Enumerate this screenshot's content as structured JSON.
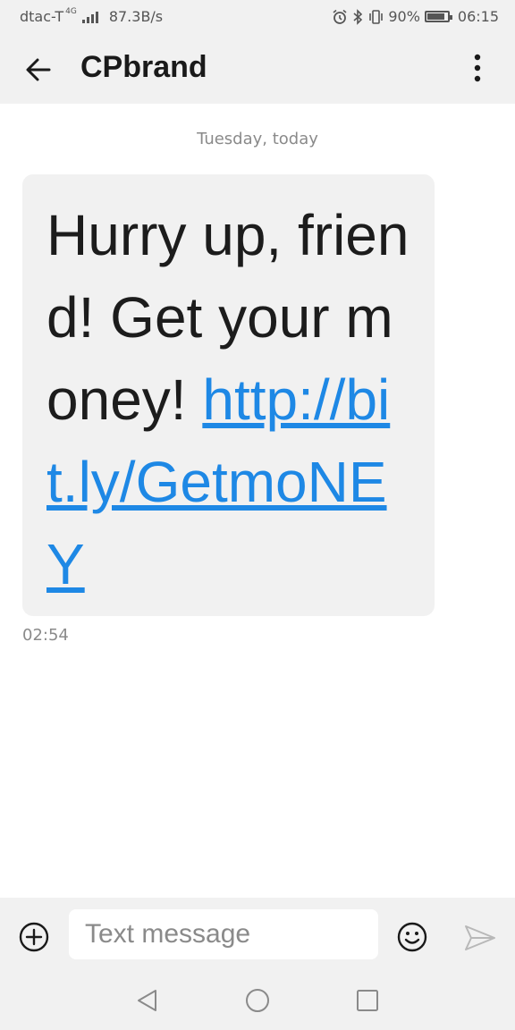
{
  "status_bar": {
    "carrier": "dtac-T",
    "network_badge": "4G",
    "speed": "87.3B/s",
    "battery": "90%",
    "battery_level": 0.9,
    "time": "06:15",
    "icons": [
      "alarm-icon",
      "bluetooth-icon",
      "vibrate-icon",
      "battery-icon",
      "signal-icon"
    ]
  },
  "header": {
    "title": "CPbrand",
    "back_icon": "arrow-left-icon",
    "menu_icon": "more-vertical-icon"
  },
  "conversation": {
    "date_label": "Tuesday, today",
    "messages": [
      {
        "text": "Hurry up, friend! Get your money! ",
        "link": "http://bit.ly/GetmoNEY",
        "time": "02:54"
      }
    ]
  },
  "composer": {
    "placeholder": "Text message",
    "value": "",
    "add_icon": "plus-circle-icon",
    "emoji_icon": "smiley-icon",
    "send_icon": "send-icon"
  },
  "nav": {
    "icons": [
      "nav-back-icon",
      "nav-home-icon",
      "nav-recent-icon"
    ]
  },
  "colors": {
    "bar_background": "#f1f1f1",
    "bubble_background": "#f1f1f1",
    "link": "#1e88e5",
    "secondary_text": "#8a8a8a"
  }
}
